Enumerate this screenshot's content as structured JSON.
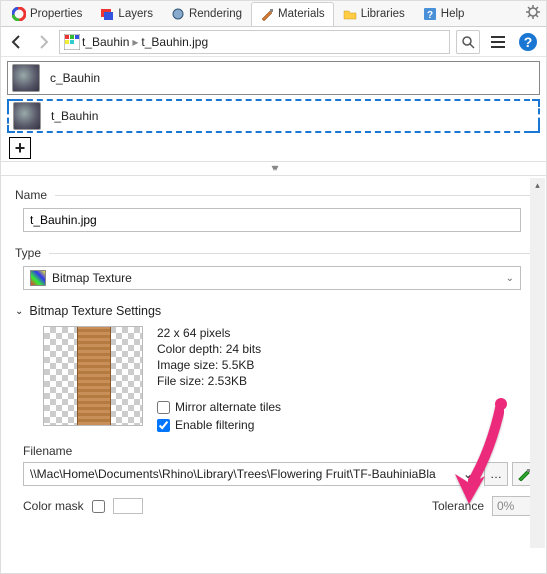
{
  "tabs": [
    {
      "label": "Properties",
      "icon": "rainbow-circle"
    },
    {
      "label": "Layers",
      "icon": "layers"
    },
    {
      "label": "Rendering",
      "icon": "render"
    },
    {
      "label": "Materials",
      "icon": "brush",
      "active": true
    },
    {
      "label": "Libraries",
      "icon": "folder"
    },
    {
      "label": "Help",
      "icon": "help"
    }
  ],
  "breadcrumb": {
    "root": "t_Bauhin",
    "leaf": "t_Bauhin.jpg"
  },
  "items": [
    {
      "label": "c_Bauhin",
      "selected": false
    },
    {
      "label": "t_Bauhin",
      "selected": true
    }
  ],
  "panel": {
    "name_label": "Name",
    "name_value": "t_Bauhin.jpg",
    "type_label": "Type",
    "type_value": "Bitmap Texture",
    "settings_label": "Bitmap Texture Settings",
    "meta": {
      "dims": "22 x 64 pixels",
      "depth": "Color depth: 24 bits",
      "imgsize": "Image size: 5.5KB",
      "filesize": "File size: 2.53KB"
    },
    "mirror_label": "Mirror alternate tiles",
    "mirror_checked": false,
    "filter_label": "Enable filtering",
    "filter_checked": true,
    "filename_label": "Filename",
    "filename_value": "\\\\Mac\\Home\\Documents\\Rhino\\Library\\Trees\\Flowering Fruit\\TF-BauhiniaBla",
    "colormask_label": "Color mask",
    "tolerance_label": "Tolerance",
    "tolerance_value": "0%"
  }
}
